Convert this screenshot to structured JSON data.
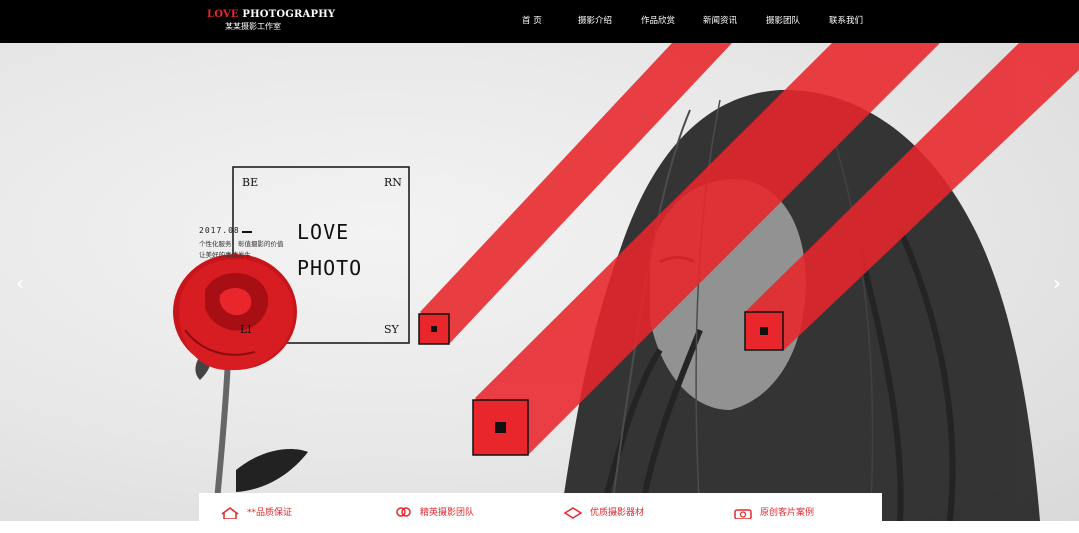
{
  "header": {
    "logo_red": "LOVE",
    "logo_white": " PHOTOGRAPHY",
    "logo_sub": "某某摄影工作室",
    "nav": [
      "首 页",
      "摄影介绍",
      "作品欣赏",
      "新闻资讯",
      "摄影团队",
      "联系我们"
    ]
  },
  "hero": {
    "corner_tl": "BE",
    "corner_tr": "RN",
    "corner_bl": "LI",
    "corner_br": "SY",
    "big_line1": "LOVE",
    "big_line2": "PHOTO",
    "date": "2017.08",
    "desc_line1": "个性化服务，彰值摄影的价值",
    "desc_line2": "让美好的事情发生",
    "prev_arrow": "‹",
    "next_arrow": "›",
    "accent_color": "#e8262b"
  },
  "features": [
    {
      "label": "**品质保证",
      "icon": "house-icon"
    },
    {
      "label": "精英摄影团队",
      "icon": "people-icon"
    },
    {
      "label": "优质摄影器材",
      "icon": "layers-icon"
    },
    {
      "label": "原创客片案例",
      "icon": "camera-icon"
    }
  ]
}
